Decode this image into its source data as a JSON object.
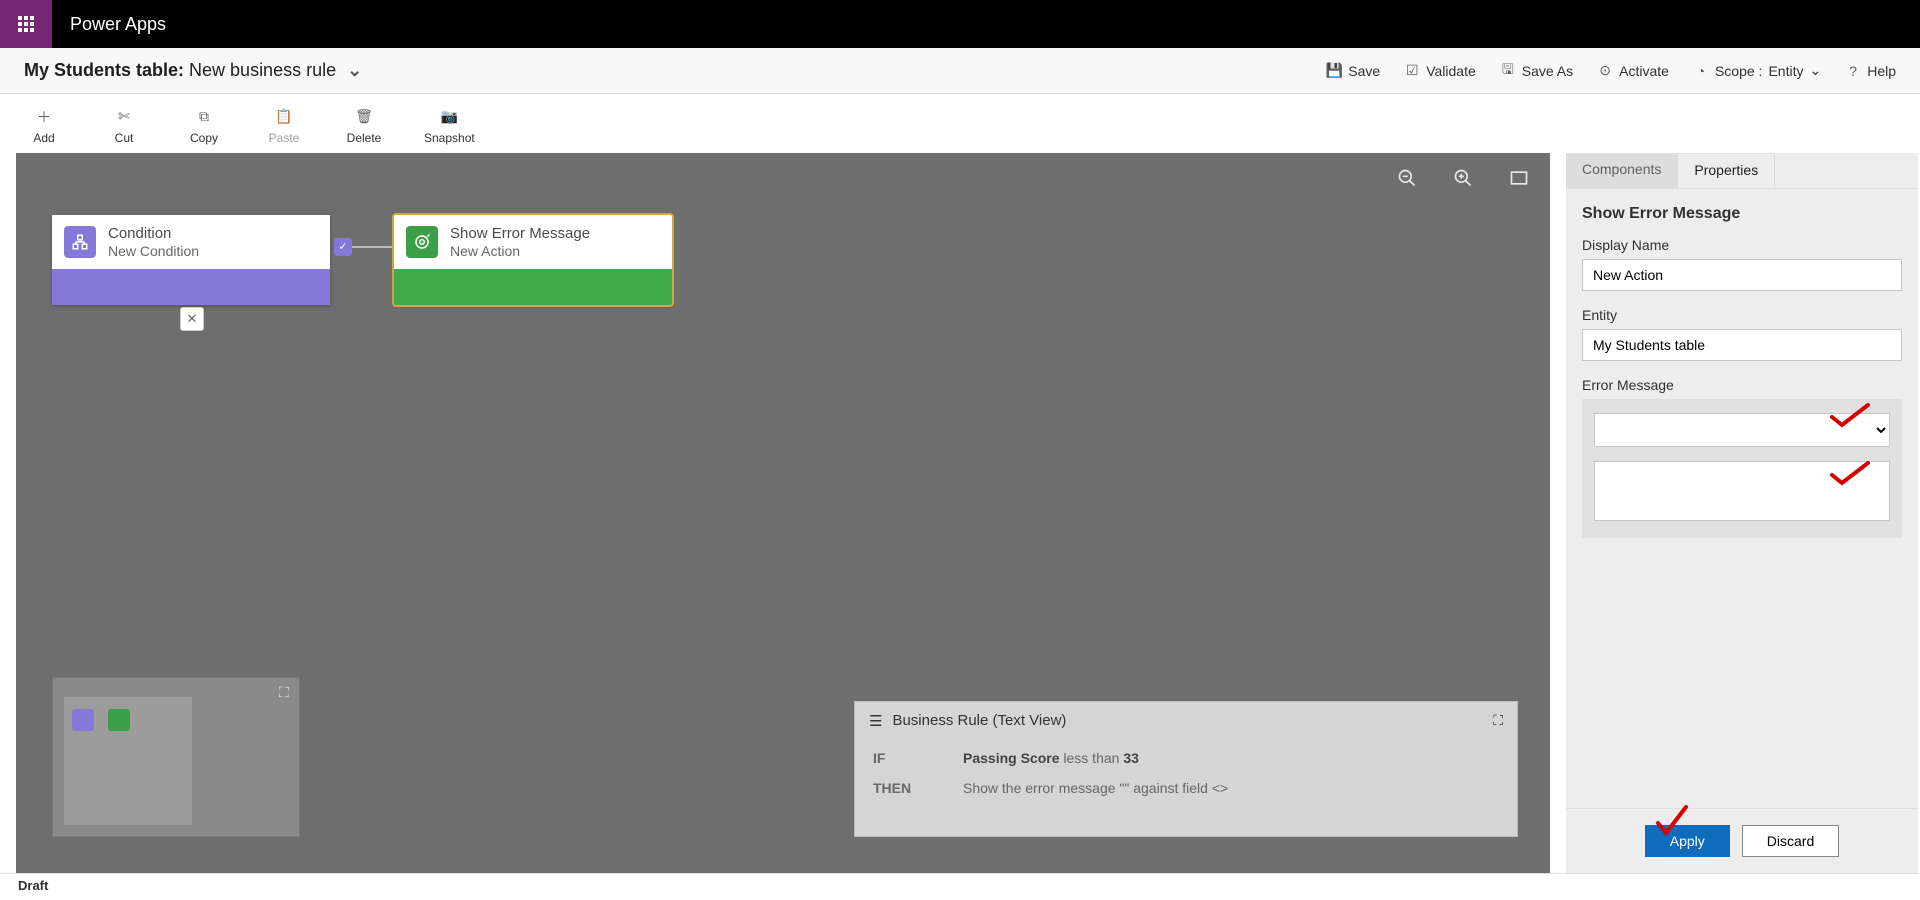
{
  "app_title": "Power Apps",
  "breadcrumb": {
    "prefix": "My Students table:",
    "title": "New business rule"
  },
  "commands": {
    "save": "Save",
    "validate": "Validate",
    "save_as": "Save As",
    "activate": "Activate",
    "scope_label": "Scope :",
    "scope_value": "Entity",
    "help": "Help"
  },
  "toolbar": {
    "add": "Add",
    "cut": "Cut",
    "copy": "Copy",
    "paste": "Paste",
    "delete": "Delete",
    "snapshot": "Snapshot"
  },
  "nodes": {
    "condition": {
      "title": "Condition",
      "subtitle": "New Condition"
    },
    "action": {
      "title": "Show Error Message",
      "subtitle": "New Action"
    }
  },
  "textview": {
    "title": "Business Rule (Text View)",
    "if_label": "IF",
    "if_value_field": "Passing Score",
    "if_value_op": "less than",
    "if_value_val": "33",
    "then_label": "THEN",
    "then_value": "Show the error message \"\" against field <>"
  },
  "sidepanel": {
    "tab_components": "Components",
    "tab_properties": "Properties",
    "section_title": "Show Error Message",
    "display_name_label": "Display Name",
    "display_name_value": "New Action",
    "entity_label": "Entity",
    "entity_value": "My Students table",
    "error_message_label": "Error Message",
    "apply": "Apply",
    "discard": "Discard"
  },
  "status": "Draft"
}
